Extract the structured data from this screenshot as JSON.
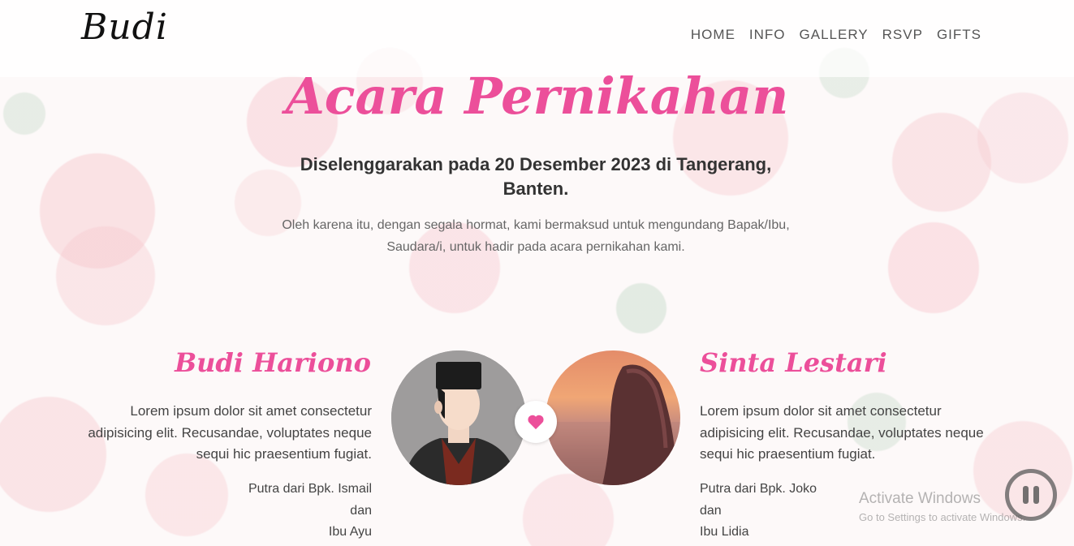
{
  "navbar": {
    "brand": "Budi",
    "links": [
      "HOME",
      "INFO",
      "GALLERY",
      "RSVP",
      "GIFTS"
    ]
  },
  "event": {
    "title": "Acara Pernikahan",
    "subtitle": "Diselenggarakan pada 20 Desember 2023 di Tangerang, Banten.",
    "lead": "Oleh karena itu, dengan segala hormat, kami bermaksud untuk mengundang Bapak/Ibu, Saudara/i, untuk hadir pada acara pernikahan kami."
  },
  "groom": {
    "name": "Budi Hariono",
    "desc": "Lorem ipsum dolor sit amet consectetur adipisicing elit. Recusandae, voluptates neque sequi hic praesentium fugiat.",
    "parents_line1": "Putra dari Bpk. Ismail",
    "parents_line2": "dan",
    "parents_line3": "Ibu Ayu"
  },
  "bride": {
    "name": "Sinta Lestari",
    "desc": "Lorem ipsum dolor sit amet consectetur adipisicing elit. Recusandae, voluptates neque sequi hic praesentium fugiat.",
    "parents_line1": "Putra dari Bpk. Joko",
    "parents_line2": "dan",
    "parents_line3": "Ibu Lidia"
  },
  "watermark": {
    "line1": "Activate Windows",
    "line2": "Go to Settings to activate Windows."
  },
  "icons": {
    "heart": "heart-icon",
    "pause": "pause-icon"
  },
  "colors": {
    "accent": "#ec4f9a",
    "text": "#444444"
  }
}
